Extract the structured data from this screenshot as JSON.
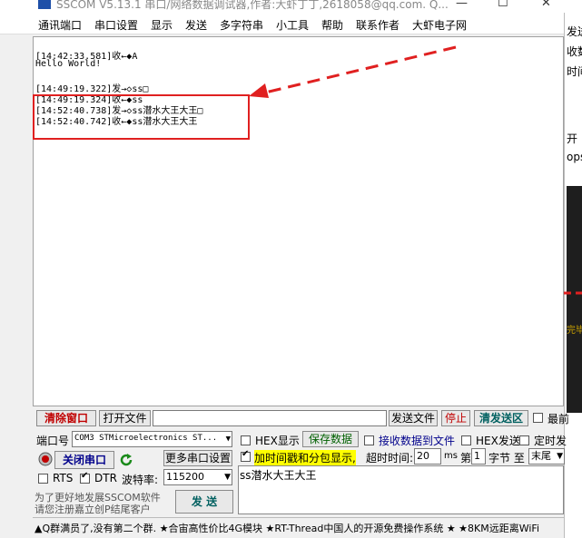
{
  "window": {
    "title": "SSCOM V5.13.1 串口/网络数据调试器,作者:大虾丁丁,2618058@qq.com. Q...",
    "min_glyph": "—",
    "max_glyph": "☐",
    "close_glyph": "✕"
  },
  "menu": [
    "通讯端口",
    "串口设置",
    "显示",
    "发送",
    "多字符串",
    "小工具",
    "帮助",
    "联系作者",
    "大虾电子网"
  ],
  "receive": {
    "lines": [
      "[14:42:33.581]收←◆A",
      "Hello World!",
      "",
      "[14:49:19.322]发→◇ss□",
      "[14:49:19.324]收←◆ss",
      "[14:52:40.738]发→◇ss潜水大王大王□",
      "[14:52:40.742]收←◆ss潜水大王大王"
    ]
  },
  "bottom_bar": {
    "clear_window": "清除窗口",
    "open_file": "打开文件",
    "file_path": "",
    "send_file": "发送文件",
    "stop": "停止",
    "clear_send": "清发送区",
    "last_label": "最前"
  },
  "port": {
    "port_label": "端口号",
    "port_value": "COM3 STMicroelectronics ST...",
    "close_port": "关闭串口",
    "more_settings": "更多串口设置",
    "rts": "RTS",
    "dtr": "DTR",
    "baud_label": "波特率:",
    "baud_value": "115200",
    "promo_line1": "为了更好地发展SSCOM软件",
    "promo_line2": "请您注册嘉立创P结尾客户",
    "send_button": "发 送"
  },
  "options": {
    "hex_display": "HEX显示",
    "save_data": "保存数据",
    "recv_to_file": "接收数据到文件",
    "hex_send": "HEX发送",
    "timed_send": "定时发",
    "timestamp": "加时间戳和分包显示,",
    "timeout_label": "超时时间:",
    "timeout_value": "20",
    "ms": "ms",
    "nth": "第",
    "byte_index": "1",
    "byte_label": "字节 至",
    "end_value": "末尾"
  },
  "send_text": "ss潜水大王大王",
  "status_text": "▲Q群满员了,没有第二个群. ★合宙高性价比4G模块 ★RT-Thread中国人的开源免费操作系统 ★ ★8KM远距离WiFi",
  "behind_window": {
    "frag1": "发送",
    "frag2": "收数",
    "frag3": "时间",
    "frag4": "开",
    "frag5": "ops",
    "frag6": "完毕"
  },
  "colors": {
    "highlight_red": "#e02020",
    "timestamp_bg": "#ffff00",
    "accent_blue": "#1e4fa8"
  }
}
